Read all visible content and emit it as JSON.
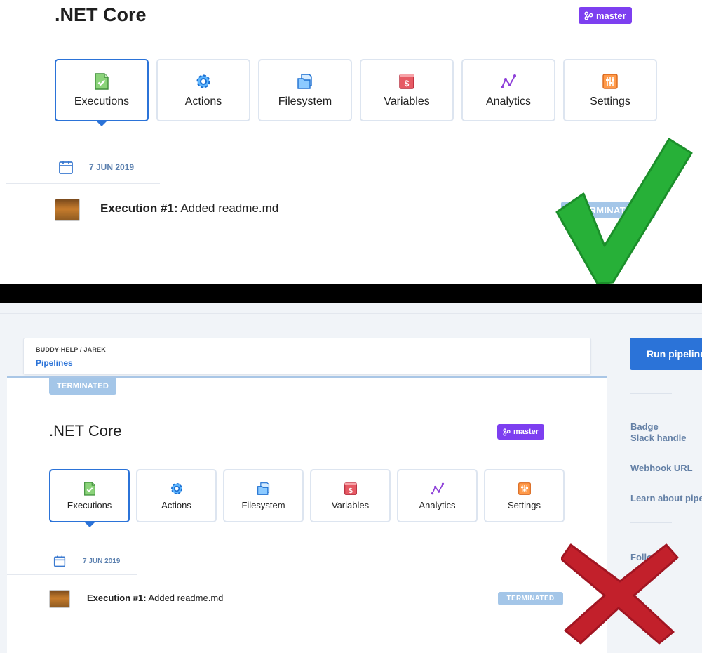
{
  "top": {
    "title": ".NET Core",
    "branch": "master",
    "tabs": [
      {
        "label": "Executions",
        "icon": "executions-icon",
        "active": true
      },
      {
        "label": "Actions",
        "icon": "actions-icon"
      },
      {
        "label": "Filesystem",
        "icon": "filesystem-icon"
      },
      {
        "label": "Variables",
        "icon": "variables-icon"
      },
      {
        "label": "Analytics",
        "icon": "analytics-icon"
      },
      {
        "label": "Settings",
        "icon": "settings-icon"
      }
    ],
    "date": "7 JUN 2019",
    "execution": {
      "label": "Execution #1:",
      "message": "Added readme.md",
      "status": "TERMINATED"
    }
  },
  "bottom": {
    "breadcrumb": "BUDDY-HELP / JAREK",
    "breadcrumb_link": "Pipelines",
    "run_button": "Run pipeline",
    "status": "TERMINATED",
    "title": ".NET Core",
    "branch": "master",
    "tabs": [
      {
        "label": "Executions",
        "icon": "executions-icon",
        "active": true
      },
      {
        "label": "Actions",
        "icon": "actions-icon"
      },
      {
        "label": "Filesystem",
        "icon": "filesystem-icon"
      },
      {
        "label": "Variables",
        "icon": "variables-icon"
      },
      {
        "label": "Analytics",
        "icon": "analytics-icon"
      },
      {
        "label": "Settings",
        "icon": "settings-icon"
      }
    ],
    "date": "7 JUN 2019",
    "execution": {
      "label": "Execution #1:",
      "message": "Added readme.md",
      "status": "TERMINATED"
    },
    "sidebar": [
      {
        "label": "Badge"
      },
      {
        "label": "Slack handle"
      },
      {
        "label": "Webhook URL"
      },
      {
        "label": "Learn about pipelines"
      },
      {
        "label": "Follow"
      }
    ]
  },
  "colors": {
    "accent": "#2b73d8",
    "branch": "#7d3ff0",
    "status_badge": "#a4c6e8",
    "check": "#27b038",
    "cross": "#c2202b"
  }
}
